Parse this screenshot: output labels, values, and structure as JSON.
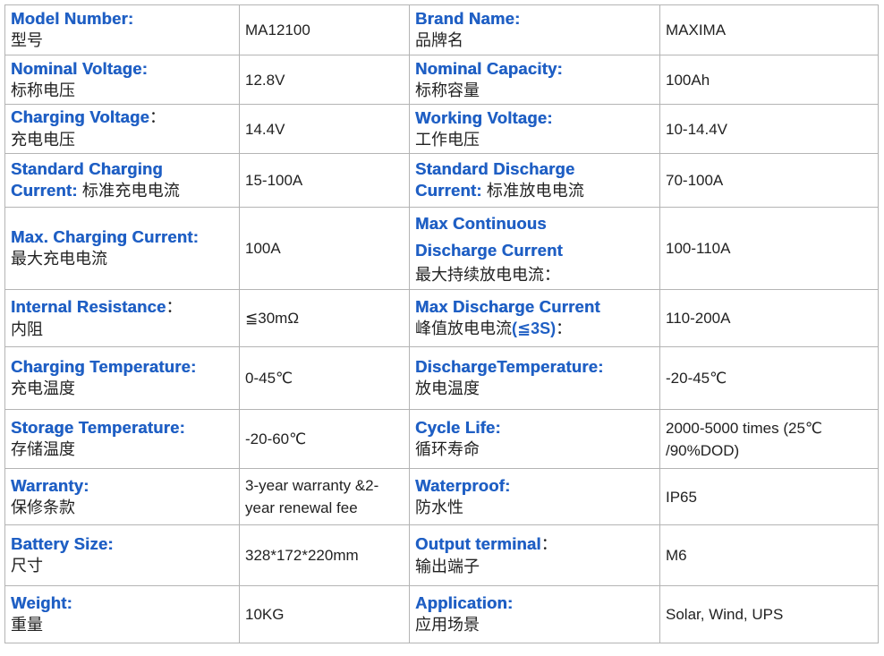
{
  "rows": [
    {
      "l": {
        "en": "Model Number:",
        "cn": "型号"
      },
      "v": "MA12100",
      "r": {
        "en": "Brand Name:",
        "cn": "品牌名"
      },
      "rv": "MAXIMA"
    },
    {
      "l": {
        "en": "Nominal Voltage:",
        "cn": "标称电压"
      },
      "v": "12.8V",
      "r": {
        "en": "Nominal Capacity:",
        "cn": "标称容量"
      },
      "rv": "100Ah"
    },
    {
      "l": {
        "en": "Charging Voltage",
        "sep": "：",
        "cn": "充电电压"
      },
      "v": "14.4V",
      "r": {
        "en": "Working Voltage:",
        "cn": "工作电压"
      },
      "rv": "10-14.4V"
    },
    {
      "l": {
        "en1": "Standard Charging",
        "en2": "Current:",
        "cn_inline": "标准充电电流"
      },
      "v": "15-100A",
      "r": {
        "en1": "Standard Discharge",
        "en2": "Current:",
        "cn_inline": "标准放电电流"
      },
      "rv": "70-100A"
    },
    {
      "l": {
        "en": "Max. Charging Current:",
        "cn": "最大充电电流"
      },
      "v": "100A",
      "r": {
        "en1": "Max Continuous",
        "en2": "Discharge Current",
        "cn": "最大持续放电电流："
      },
      "rv": "100-110A"
    },
    {
      "l": {
        "en": "Internal Resistance",
        "sep": "：",
        "cn": "内阻"
      },
      "v": "≦30mΩ",
      "r": {
        "en": "Max Discharge Current",
        "cn_pre": "峰值放电电流",
        "cn_bold": "(≦3S)",
        "cn_post": "："
      },
      "rv": "110-200A"
    },
    {
      "l": {
        "en": "Charging Temperature:",
        "cn": "充电温度"
      },
      "v": "0-45℃",
      "r": {
        "en": "DischargeTemperature:",
        "cn": "放电温度"
      },
      "rv": "-20-45℃"
    },
    {
      "l": {
        "en": "Storage Temperature:",
        "cn": "存储温度"
      },
      "v": "-20-60℃",
      "r": {
        "en": "Cycle Life:",
        "cn": "循环寿命"
      },
      "rv1": "2000-5000 times (25℃",
      "rv2": "/90%DOD)"
    },
    {
      "l": {
        "en": "Warranty:",
        "cn": "保修条款"
      },
      "v1": "3-year warranty &2-",
      "v2": "year renewal fee",
      "r": {
        "en": "Waterproof:",
        "cn": "防水性"
      },
      "rv": "IP65"
    },
    {
      "l": {
        "en": "Battery Size:",
        "cn": "尺寸"
      },
      "v": "328*172*220mm",
      "r": {
        "en": "Output terminal",
        "sep": "：",
        "cn": "输出端子"
      },
      "rv": "M6"
    },
    {
      "l": {
        "en": "Weight:",
        "cn": "重量"
      },
      "v": "10KG",
      "r": {
        "en": "Application:",
        "cn": "应用场景"
      },
      "rv": "Solar, Wind, UPS"
    }
  ]
}
